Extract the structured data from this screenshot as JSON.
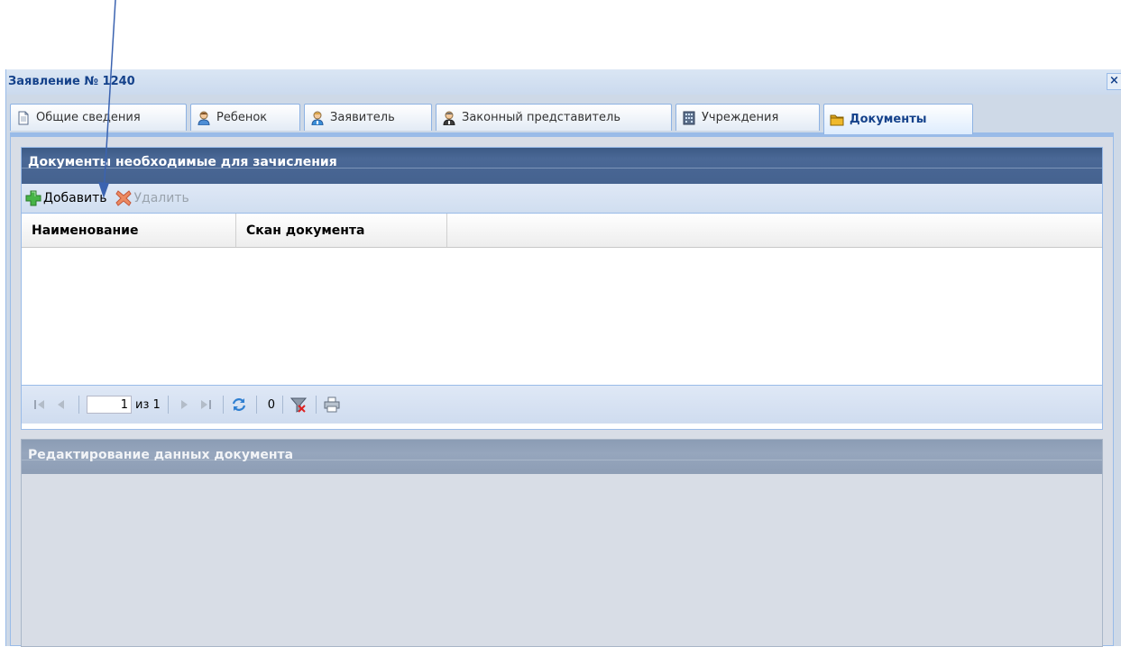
{
  "window": {
    "title": "Заявление № 1240",
    "close_glyph": "×"
  },
  "tabs": [
    {
      "label": "Общие сведения",
      "icon": "document-icon"
    },
    {
      "label": "Ребенок",
      "icon": "child-icon"
    },
    {
      "label": "Заявитель",
      "icon": "applicant-icon"
    },
    {
      "label": "Законный представитель",
      "icon": "representative-icon"
    },
    {
      "label": "Учреждения",
      "icon": "building-icon"
    },
    {
      "label": "Документы",
      "icon": "folder-icon",
      "active": true
    }
  ],
  "documents_panel": {
    "title": "Документы необходимые для зачисления",
    "toolbar": {
      "add_label": "Добавить",
      "delete_label": "Удалить"
    },
    "columns": [
      "Наименование",
      "Скан документа"
    ],
    "rows": [],
    "pager": {
      "page": "1",
      "of_total": "из 1",
      "count": "0"
    }
  },
  "edit_panel": {
    "title": "Редактирование данных документа"
  },
  "colors": {
    "panel_header": "#45628f",
    "panel_header_disabled": "#8d9db5",
    "window_bg": "#ced9e7",
    "border": "#99bbe8",
    "add_green": "#3fa63f",
    "delete_red": "#e0744e"
  }
}
